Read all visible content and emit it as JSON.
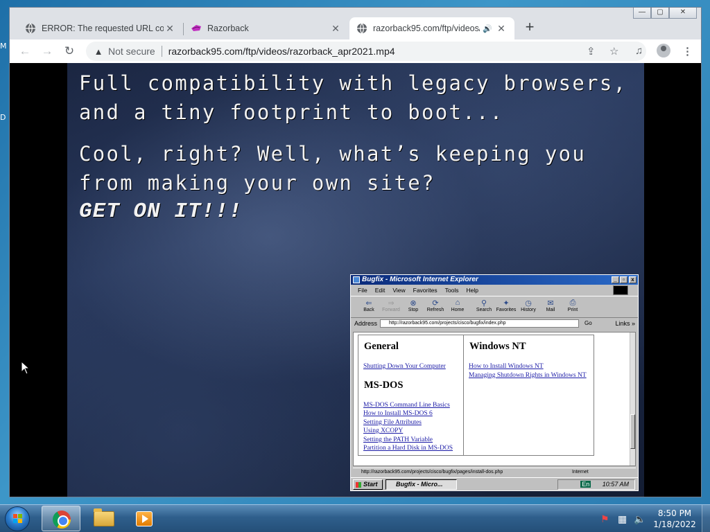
{
  "desktop": {
    "fragment_m": "M",
    "fragment_d": "D"
  },
  "browser": {
    "tabs": [
      {
        "title": "ERROR: The requested URL could",
        "close": "✕"
      },
      {
        "title": "Razorback",
        "close": "✕"
      },
      {
        "title": "razorback95.com/ftp/videos/",
        "close": "✕",
        "audio": "🔊"
      }
    ],
    "new_tab": "+",
    "window_controls": {
      "minimize": "—",
      "maximize": "▢",
      "close": "✕"
    },
    "nav": {
      "back": "←",
      "forward": "→",
      "reload": "↻"
    },
    "omnibox": {
      "security_icon": "▲",
      "security_label": "Not secure",
      "url": "razorback95.com/ftp/videos/razorback_apr2021.mp4"
    },
    "toolbar_icons": {
      "share": "⇪",
      "star": "☆",
      "media": "♫",
      "menu": "⋮"
    }
  },
  "video": {
    "lines": [
      "Full compatibility with legacy browsers,",
      "and a tiny footprint to boot...",
      "Cool, right? Well, what’s keeping you",
      "from making your own site?"
    ],
    "shout": "GET ON IT!!!",
    "ie_window": {
      "title": "Bugfix - Microsoft Internet Explorer",
      "menu": [
        "File",
        "Edit",
        "View",
        "Favorites",
        "Tools",
        "Help"
      ],
      "toolbar": [
        {
          "label": "Back",
          "glyph": "⇐",
          "enabled": true
        },
        {
          "label": "Forward",
          "glyph": "⇒",
          "enabled": false
        },
        {
          "label": "Stop",
          "glyph": "⊗",
          "enabled": true
        },
        {
          "label": "Refresh",
          "glyph": "⟳",
          "enabled": true
        },
        {
          "label": "Home",
          "glyph": "⌂",
          "enabled": true
        },
        {
          "label": "Search",
          "glyph": "⚲",
          "enabled": true
        },
        {
          "label": "Favorites",
          "glyph": "✦",
          "enabled": true
        },
        {
          "label": "History",
          "glyph": "◷",
          "enabled": true
        },
        {
          "label": "Mail",
          "glyph": "✉",
          "enabled": true
        },
        {
          "label": "Print",
          "glyph": "⎙",
          "enabled": true
        }
      ],
      "address_label": "Address",
      "address_url": "http://razorback95.com/projects/cisco/bugfix/index.php",
      "go_label": "Go",
      "links_label": "Links »",
      "sections": {
        "general": {
          "heading": "General",
          "links": [
            "Shutting Down Your Computer"
          ]
        },
        "msdos": {
          "heading": "MS-DOS",
          "links": [
            "MS-DOS Command Line Basics",
            "How to Install MS-DOS 6",
            "Setting File Attributes",
            "Using XCOPY",
            "Setting the PATH Variable",
            "Partition a Hard Disk in MS-DOS"
          ]
        },
        "windows_nt": {
          "heading": "Windows NT",
          "links": [
            "How to Install Windows NT",
            "Managing Shutdown Rights in Windows NT"
          ]
        }
      },
      "status_url": "http://razorback95.com/projects/cisco/bugfix/pages/install-dos.php",
      "status_zone": "Internet",
      "taskbar": {
        "start": "Start",
        "task": "Bugfix - Micro...",
        "lang": "En",
        "clock": "10:57 AM"
      }
    }
  },
  "taskbar": {
    "clock_time": "8:50 PM",
    "clock_date": "1/18/2022",
    "tray": {
      "flag": "⚑",
      "network": "▦",
      "volume": "🔈"
    }
  }
}
